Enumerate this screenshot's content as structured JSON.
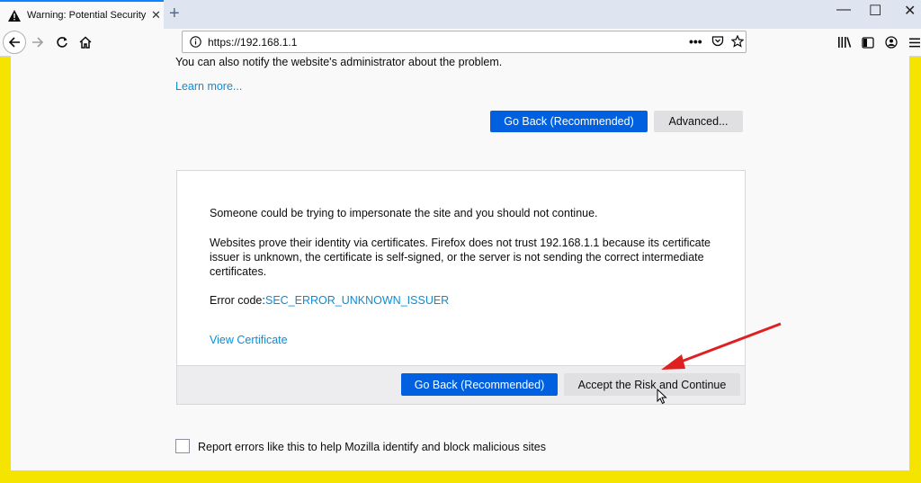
{
  "tab": {
    "title": "Warning: Potential Security Ris",
    "close": "✕",
    "new_tab": "+"
  },
  "window": {
    "minimize": "—",
    "maximize": "☐",
    "close": "✕"
  },
  "url": {
    "text": "https://192.168.1.1"
  },
  "page": {
    "notify_text": "You can also notify the website's administrator about the problem.",
    "learn_more": "Learn more...",
    "go_back_top": "Go Back (Recommended)",
    "advanced": "Advanced...",
    "panel": {
      "impersonate": "Someone could be trying to impersonate the site and you should not continue.",
      "cert_line1": "Websites prove their identity via certificates. Firefox does not trust 192.168.1.1 because its certificate",
      "cert_line2": "issuer is unknown, the certificate is self-signed, or the server is not sending the correct intermediate",
      "cert_line3": "certificates.",
      "error_label": "Error code:",
      "error_code": "SEC_ERROR_UNKNOWN_ISSUER",
      "view_certificate": "View Certificate",
      "go_back": "Go Back (Recommended)",
      "accept_risk": "Accept the Risk and Continue"
    },
    "report_errors": "Report errors like this to help Mozilla identify and block malicious sites"
  },
  "colors": {
    "frame": "#f5e300",
    "primary": "#0060df",
    "link": "#0a8dd8",
    "arrow": "#e02020"
  }
}
